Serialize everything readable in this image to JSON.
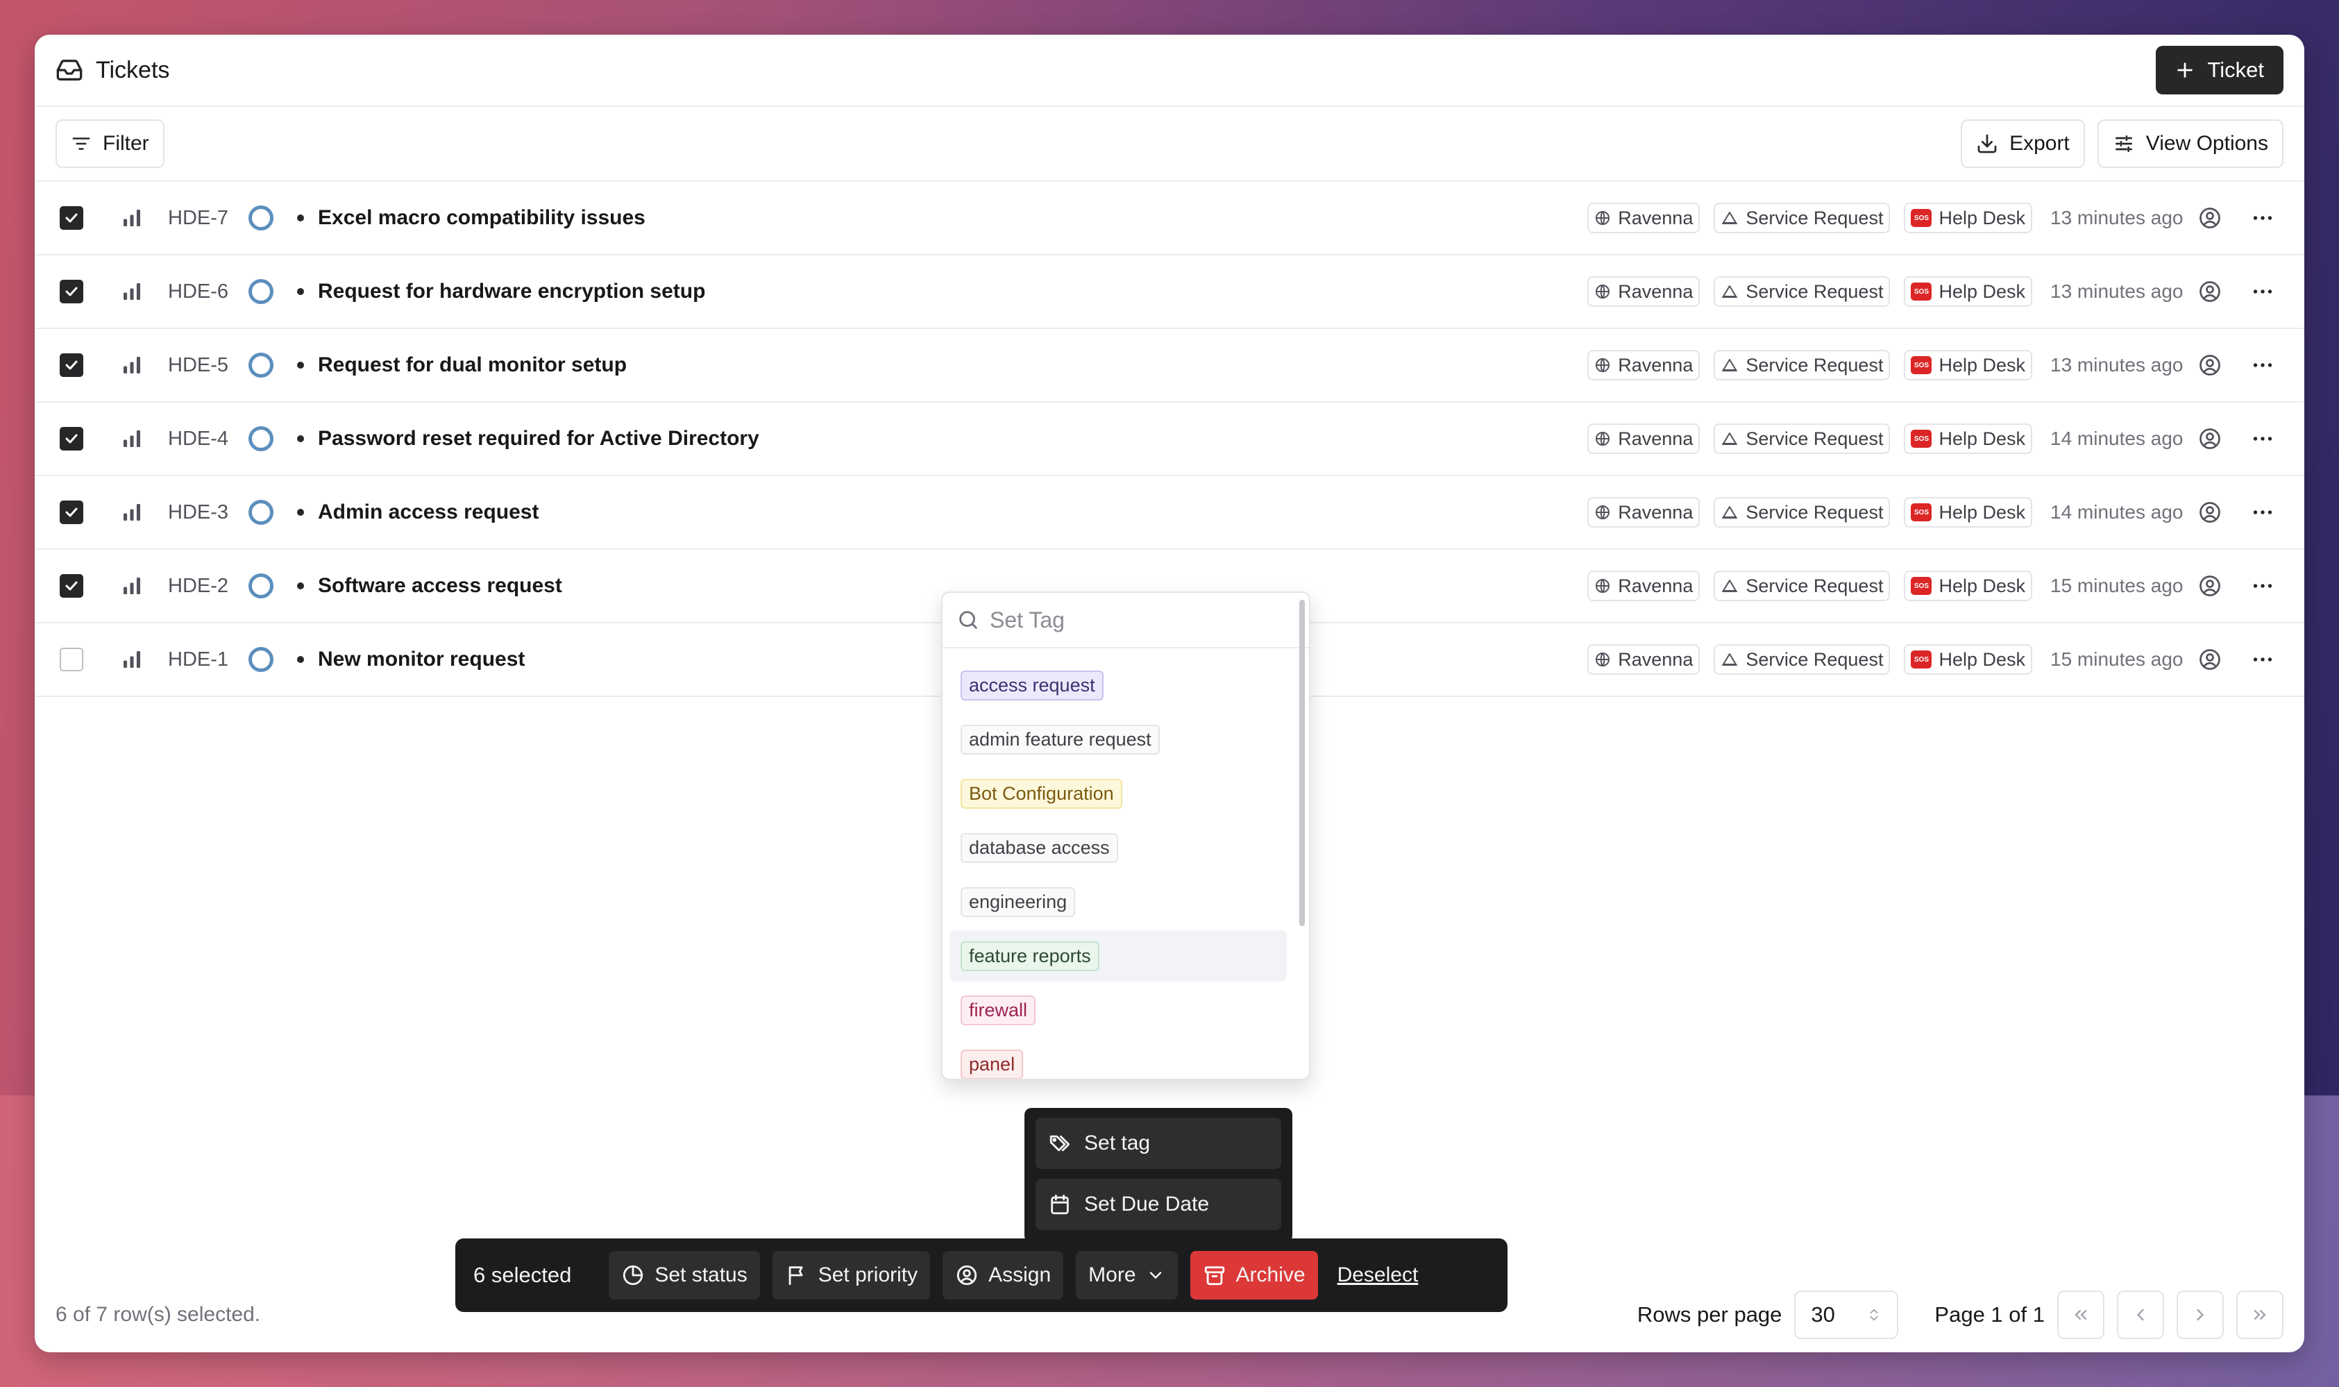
{
  "header": {
    "title": "Tickets",
    "new_ticket_label": "Ticket"
  },
  "toolbar": {
    "filter_label": "Filter",
    "export_label": "Export",
    "view_options_label": "View Options"
  },
  "rows": [
    {
      "id": "HDE-7",
      "title": "Excel macro compatibility issues",
      "checked": true,
      "project": "Ravenna",
      "type": "Service Request",
      "queue": "Help Desk",
      "time": "13 minutes ago"
    },
    {
      "id": "HDE-6",
      "title": "Request for hardware encryption setup",
      "checked": true,
      "project": "Ravenna",
      "type": "Service Request",
      "queue": "Help Desk",
      "time": "13 minutes ago"
    },
    {
      "id": "HDE-5",
      "title": "Request for dual monitor setup",
      "checked": true,
      "project": "Ravenna",
      "type": "Service Request",
      "queue": "Help Desk",
      "time": "13 minutes ago"
    },
    {
      "id": "HDE-4",
      "title": "Password reset required for Active Directory",
      "checked": true,
      "project": "Ravenna",
      "type": "Service Request",
      "queue": "Help Desk",
      "time": "14 minutes ago"
    },
    {
      "id": "HDE-3",
      "title": "Admin access request",
      "checked": true,
      "project": "Ravenna",
      "type": "Service Request",
      "queue": "Help Desk",
      "time": "14 minutes ago"
    },
    {
      "id": "HDE-2",
      "title": "Software access request",
      "checked": true,
      "project": "Ravenna",
      "type": "Service Request",
      "queue": "Help Desk",
      "time": "15 minutes ago"
    },
    {
      "id": "HDE-1",
      "title": "New monitor request",
      "checked": false,
      "project": "Ravenna",
      "type": "Service Request",
      "queue": "Help Desk",
      "time": "15 minutes ago"
    }
  ],
  "tag_dropdown": {
    "placeholder": "Set Tag",
    "value": "",
    "tags": [
      {
        "label": "access request",
        "bg": "#ece9fb",
        "border": "#c9c1f0",
        "color": "#3b3272",
        "hover": false
      },
      {
        "label": "admin feature request",
        "bg": "#fafafa",
        "border": "#e4e4e7",
        "color": "#3f3f46",
        "hover": false
      },
      {
        "label": "Bot Configuration",
        "bg": "#fdf8dc",
        "border": "#f3e5a0",
        "color": "#7a5a10",
        "hover": false
      },
      {
        "label": "database access",
        "bg": "#fafafa",
        "border": "#e4e4e7",
        "color": "#3f3f46",
        "hover": false
      },
      {
        "label": "engineering",
        "bg": "#fafafa",
        "border": "#e4e4e7",
        "color": "#3f3f46",
        "hover": false
      },
      {
        "label": "feature reports",
        "bg": "#eaf5ec",
        "border": "#c4e3ca",
        "color": "#2c4a33",
        "hover": true
      },
      {
        "label": "firewall",
        "bg": "#fdeef3",
        "border": "#f6c6d6",
        "color": "#9d2251",
        "hover": false
      },
      {
        "label": "panel",
        "bg": "#fdeeee",
        "border": "#f5c7c7",
        "color": "#8f2a2a",
        "hover": false
      }
    ]
  },
  "more_menu": {
    "set_tag_label": "Set tag",
    "set_due_date_label": "Set Due Date"
  },
  "action_bar": {
    "selected_label": "6 selected",
    "set_status_label": "Set status",
    "set_priority_label": "Set priority",
    "assign_label": "Assign",
    "more_label": "More",
    "archive_label": "Archive",
    "deselect_label": "Deselect"
  },
  "footer": {
    "selection_text": "6 of 7 row(s) selected.",
    "rows_per_page_label": "Rows per page",
    "rows_per_page_value": "30",
    "page_label": "Page 1 of 1"
  }
}
